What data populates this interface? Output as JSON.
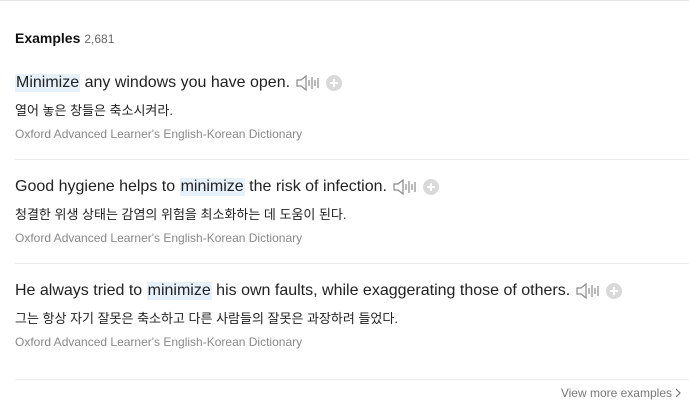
{
  "header": {
    "title": "Examples",
    "count": "2,681"
  },
  "examples": [
    {
      "before": "",
      "highlight": "Minimize",
      "after": " any windows you have open.",
      "translation": "열어 놓은 창들은 축소시켜라.",
      "source": "Oxford Advanced Learner's English-Korean Dictionary"
    },
    {
      "before": "Good hygiene helps to ",
      "highlight": "minimize",
      "after": " the risk of infection.",
      "translation": "청결한 위생 상태는 감염의 위험을 최소화하는 데 도움이 된다.",
      "source": "Oxford Advanced Learner's English-Korean Dictionary"
    },
    {
      "before": "He always tried to ",
      "highlight": "minimize",
      "after": " his own faults, while exaggerating those of others.",
      "translation": "그는 항상 자기 잘못은 축소하고 다른 사람들의 잘못은 과장하려 들었다.",
      "source": "Oxford Advanced Learner's English-Korean Dictionary"
    }
  ],
  "footer": {
    "view_more": "View more examples"
  },
  "icons": {
    "sound": "speaker-icon",
    "add": "plus-icon",
    "more": "chevron-right-icon"
  },
  "colors": {
    "highlight_bg": "#e6f1fb",
    "icon_gray": "#d9d9d9",
    "source_text": "#888888"
  }
}
